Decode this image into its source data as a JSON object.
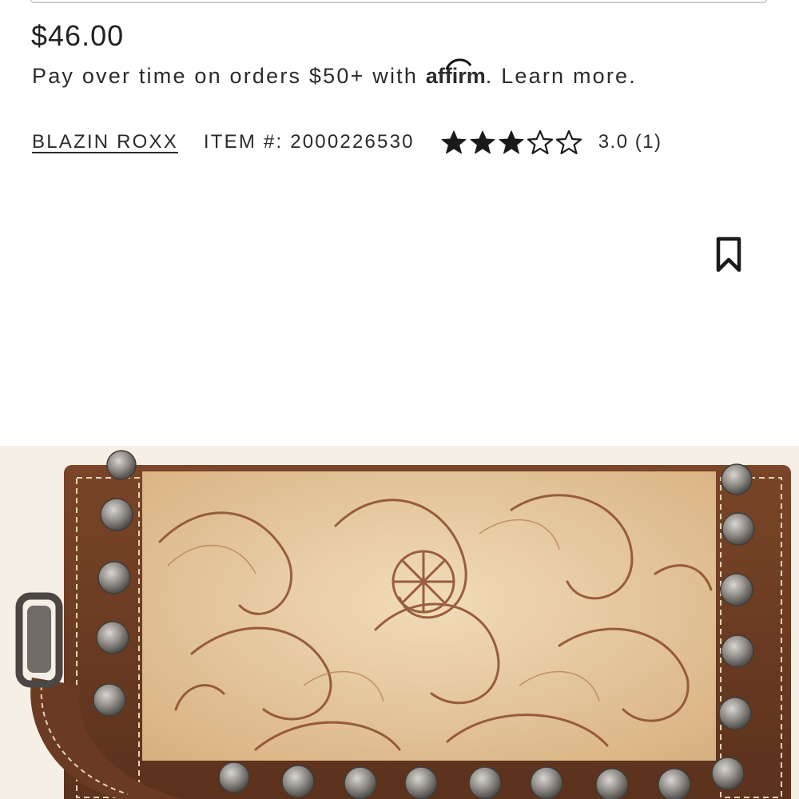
{
  "product": {
    "price": "$46.00",
    "financing": {
      "prefix": "Pay over time on orders $50+ with ",
      "provider": "affirm",
      "suffix": ". ",
      "link_label": "Learn more."
    },
    "brand": "BLAZIN ROXX",
    "item_number": "ITEM #: 2000226530",
    "rating": {
      "value": 3.0,
      "max": 5,
      "text": "3.0 (1)"
    }
  },
  "icons": {
    "bookmark": "bookmark-icon",
    "star_filled": "star-filled-icon",
    "star_empty": "star-outline-icon"
  },
  "colors": {
    "text": "#222222",
    "leather_dark": "#6b3a22",
    "leather_light": "#e9cfa6",
    "stud": "#8e8a86"
  }
}
